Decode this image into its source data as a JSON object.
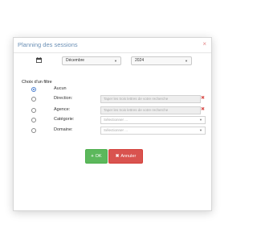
{
  "dialog": {
    "title": "Planning des sessions",
    "close_glyph": "×"
  },
  "period": {
    "month": "Décembre",
    "year": "2024"
  },
  "filter": {
    "section_title": "Choix d'un filtre",
    "options": [
      {
        "label": "Aucun",
        "checked": true
      },
      {
        "label": "Direction:",
        "input_placeholder": "Taper les trois lettres de votre recherche"
      },
      {
        "label": "Agence:",
        "input_placeholder": "Taper les trois lettres de votre recherche"
      },
      {
        "label": "Catégorie:",
        "select_placeholder": "Sélectionner ..."
      },
      {
        "label": "Domaine:",
        "select_placeholder": "Sélectionner ..."
      }
    ]
  },
  "buttons": {
    "ok_label": "OK",
    "cancel_label": "Annuler"
  },
  "colors": {
    "title": "#6a8fb5",
    "ok": "#5cb85c",
    "cancel": "#d9534f"
  },
  "icons": {
    "calendar": "calendar-icon",
    "ok": "plus-icon",
    "cancel": "times-icon"
  }
}
